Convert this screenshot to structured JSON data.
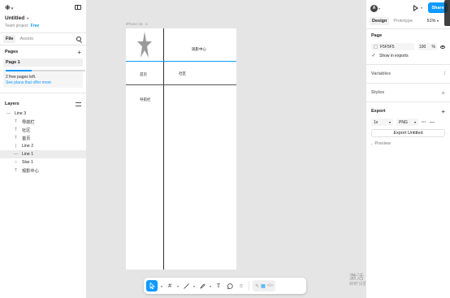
{
  "left_panel": {
    "doc_title": "Untitled",
    "team": "Team project",
    "plan": "Free",
    "tabs": [
      "File",
      "Assets"
    ],
    "pages_label": "Pages",
    "page_name": "Page 1",
    "notice_text": "2 free pages left.",
    "notice_link": "See plans that offer more",
    "pages_used_fraction": 0.33,
    "layers_label": "Layers",
    "layers": [
      {
        "icon": "—",
        "name": "Line 3",
        "level": 0
      },
      {
        "icon": "#",
        "name": "iPhone 16 - 1",
        "level": 0,
        "frame": true
      },
      {
        "icon": "T",
        "name": "导航栏",
        "level": 1
      },
      {
        "icon": "T",
        "name": "社区",
        "level": 1
      },
      {
        "icon": "T",
        "name": "首页",
        "level": 1
      },
      {
        "icon": "|",
        "name": "Line 2",
        "level": 1
      },
      {
        "icon": "—",
        "name": "Line 1",
        "level": 1,
        "selected": true
      },
      {
        "icon": "☆",
        "name": "Star 1",
        "level": 1
      },
      {
        "icon": "T",
        "name": "观影中心",
        "level": 1
      }
    ]
  },
  "canvas": {
    "frame_label": "iPhone 16 - 1",
    "texts": {
      "center": "观影中心",
      "home": "首页",
      "community": "社区",
      "navbar": "导航栏"
    }
  },
  "toolbar": {
    "tools": [
      "move",
      "frame",
      "line",
      "pen",
      "text",
      "comment",
      "actions"
    ]
  },
  "watermark": {
    "line1": "激活 Windows",
    "line2": "转到\"设置\"以激活 Windows。"
  },
  "right_panel": {
    "avatar_initial": "A",
    "share_label": "Share",
    "tabs": [
      "Design",
      "Prototype"
    ],
    "zoom": "51%",
    "page_label": "Page",
    "page_color": "F5F5F5",
    "page_opacity": "100",
    "opacity_unit": "%",
    "show_in_exports": "Show in exports",
    "variables_label": "Variables",
    "styles_label": "Styles",
    "export_label": "Export",
    "export_scale": "1x",
    "export_format": "PNG",
    "export_button": "Export Untitled",
    "preview_label": "Preview"
  },
  "colors": {
    "accent": "#0d99ff",
    "canvas_bg": "#e5e5e5"
  }
}
